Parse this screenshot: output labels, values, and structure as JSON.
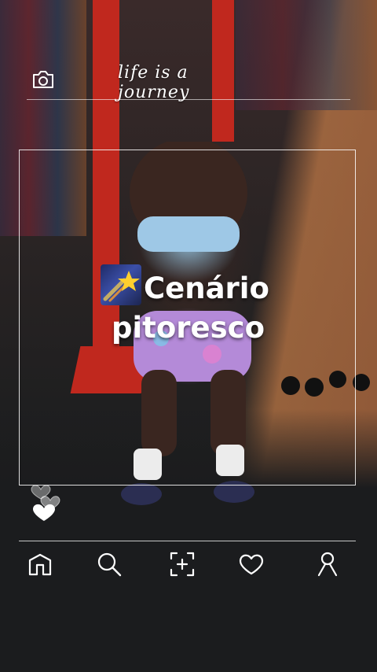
{
  "overlay": {
    "tagline": "life is a journey",
    "title_line1": "Cenário",
    "title_line2": "pitoresco",
    "title_emoji": "shooting-star-emoji"
  },
  "icons": {
    "top": "camera-icon",
    "reactions": [
      "heart-outline-icon",
      "heart-outline-icon",
      "heart-filled-icon"
    ]
  },
  "nav": {
    "items": [
      "home-icon",
      "search-icon",
      "add-post-icon",
      "heart-icon",
      "profile-icon"
    ]
  }
}
